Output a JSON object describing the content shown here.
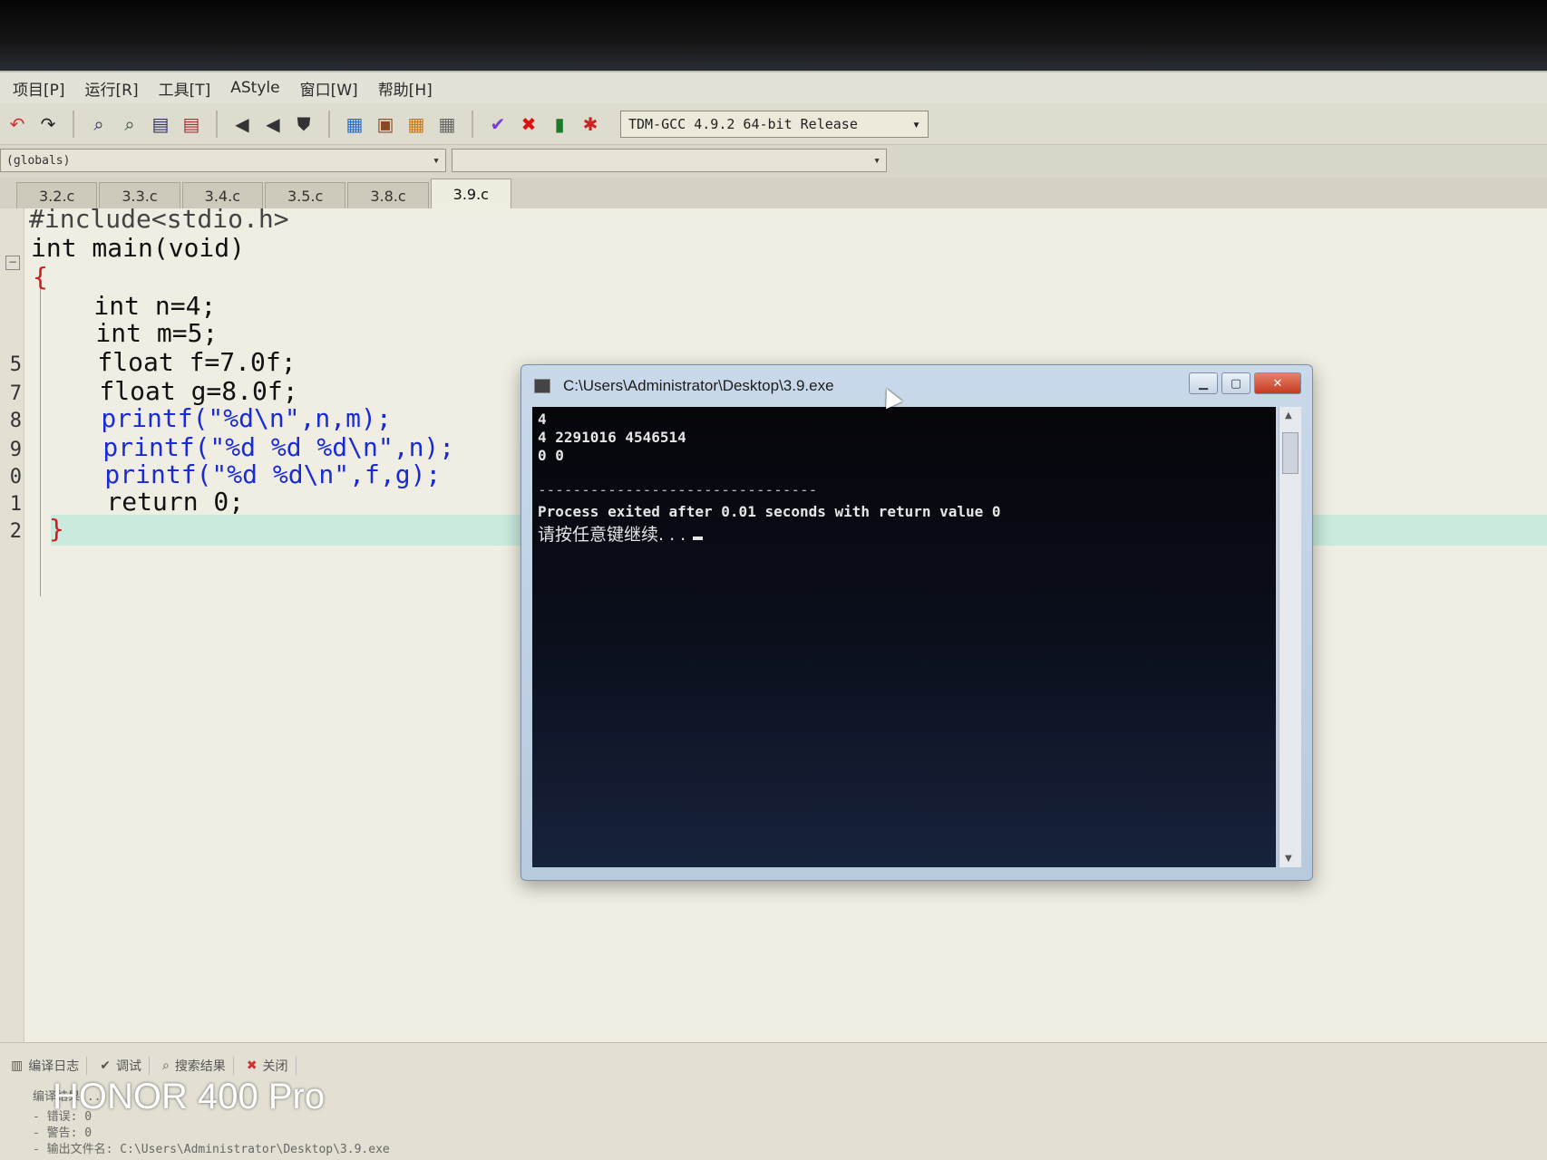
{
  "menubar": {
    "items": [
      "项目[P]",
      "运行[R]",
      "工具[T]",
      "AStyle",
      "窗口[W]",
      "帮助[H]"
    ]
  },
  "toolbar": {
    "compiler": "TDM-GCC 4.9.2 64-bit Release"
  },
  "scope": {
    "left_value": "(globals)",
    "right_value": ""
  },
  "tabs": [
    "3.2.c",
    "3.3.c",
    "3.4.c",
    "3.5.c",
    "3.8.c",
    "3.9.c"
  ],
  "active_tab": "3.9.c",
  "editor": {
    "line_numbers": [
      "",
      "",
      "",
      "",
      "",
      "5",
      "7",
      "8",
      "9",
      "0",
      "1",
      "2"
    ],
    "lines": [
      "#include<stdio.h>",
      "int main(void)",
      "{",
      "    int n=4;",
      "    int m=5;",
      "    float f=7.0f;",
      "    float g=8.0f;",
      "    printf(\"%d\\n\",n,m);",
      "    printf(\"%d %d %d\\n\",n);",
      "    printf(\"%d %d\\n\",f,g);",
      "    return 0;",
      "}"
    ]
  },
  "console": {
    "title": "C:\\Users\\Administrator\\Desktop\\3.9.exe",
    "output_lines": [
      "4",
      "4 2291016 4546514",
      "0 0",
      "",
      "--------------------------------",
      "Process exited after 0.01 seconds with return value 0"
    ],
    "prompt": "请按任意键继续. . ."
  },
  "bottom_panel": {
    "tabs": [
      "编译日志",
      "调试",
      "搜索结果",
      "关闭"
    ],
    "log_lines": [
      "编译结果...",
      "- 错误: 0",
      "- 警告: 0",
      "- 输出文件名: C:\\Users\\Administrator\\Desktop\\3.9.exe"
    ]
  },
  "watermark": "HONOR 400 Pro"
}
